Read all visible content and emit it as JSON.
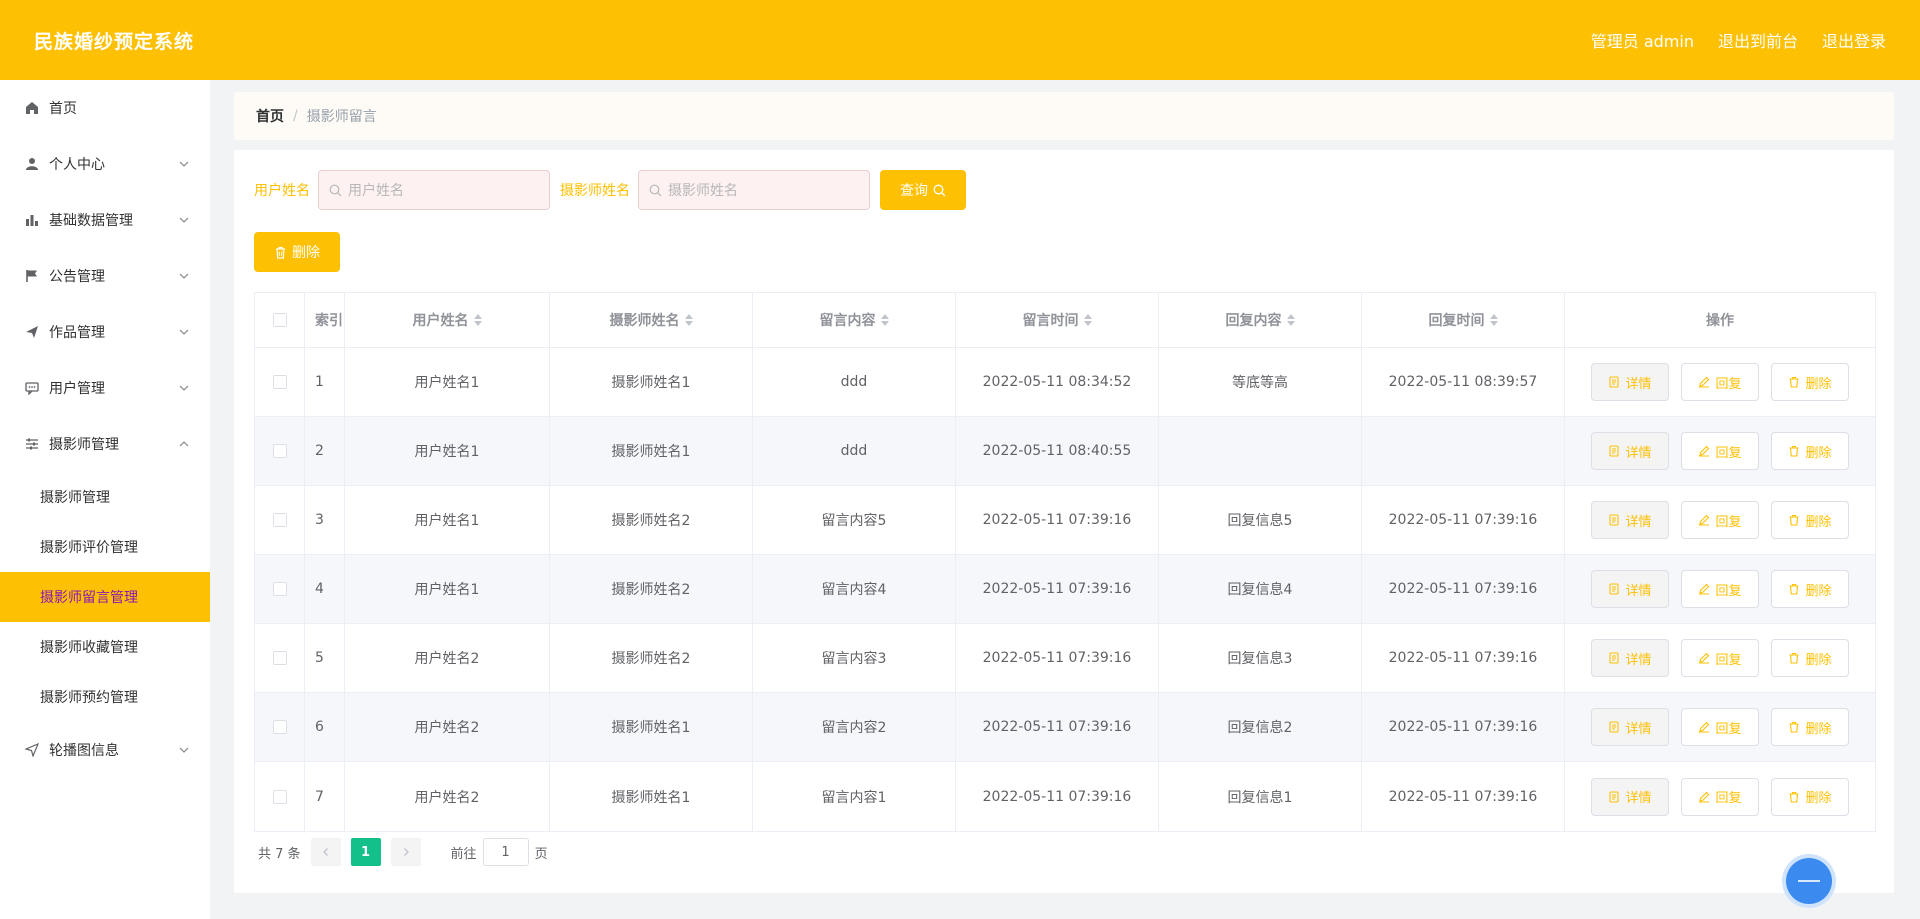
{
  "header": {
    "title": "民族婚纱预定系统",
    "admin": "管理员 admin",
    "to_front": "退出到前台",
    "logout": "退出登录"
  },
  "sidebar": {
    "items": [
      {
        "label": "首页",
        "icon": "home-icon"
      },
      {
        "label": "个人中心",
        "icon": "user-icon"
      },
      {
        "label": "基础数据管理",
        "icon": "bar-chart-icon"
      },
      {
        "label": "公告管理",
        "icon": "flag-icon"
      },
      {
        "label": "作品管理",
        "icon": "send-icon"
      },
      {
        "label": "用户管理",
        "icon": "chat-icon"
      },
      {
        "label": "摄影师管理",
        "icon": "sliders-icon"
      },
      {
        "label": "轮播图信息",
        "icon": "navigation-icon"
      }
    ],
    "sub_items": [
      "摄影师管理",
      "摄影师评价管理",
      "摄影师留言管理",
      "摄影师收藏管理",
      "摄影师预约管理"
    ]
  },
  "breadcrumb": {
    "home": "首页",
    "separator": "/",
    "current": "摄影师留言"
  },
  "filters": {
    "user_label": "用户姓名",
    "user_placeholder": "用户姓名",
    "photographer_label": "摄影师姓名",
    "photographer_placeholder": "摄影师姓名",
    "query_button": "查询",
    "delete_button": "删除"
  },
  "table": {
    "headers": [
      "索引",
      "用户姓名",
      "摄影师姓名",
      "留言内容",
      "留言时间",
      "回复内容",
      "回复时间",
      "操作"
    ],
    "rows": [
      [
        "1",
        "用户姓名1",
        "摄影师姓名1",
        "ddd",
        "2022-05-11 08:34:52",
        "等底等高",
        "2022-05-11 08:39:57"
      ],
      [
        "2",
        "用户姓名1",
        "摄影师姓名1",
        "ddd",
        "2022-05-11 08:40:55",
        "",
        ""
      ],
      [
        "3",
        "用户姓名1",
        "摄影师姓名2",
        "留言内容5",
        "2022-05-11 07:39:16",
        "回复信息5",
        "2022-05-11 07:39:16"
      ],
      [
        "4",
        "用户姓名1",
        "摄影师姓名2",
        "留言内容4",
        "2022-05-11 07:39:16",
        "回复信息4",
        "2022-05-11 07:39:16"
      ],
      [
        "5",
        "用户姓名2",
        "摄影师姓名2",
        "留言内容3",
        "2022-05-11 07:39:16",
        "回复信息3",
        "2022-05-11 07:39:16"
      ],
      [
        "6",
        "用户姓名2",
        "摄影师姓名1",
        "留言内容2",
        "2022-05-11 07:39:16",
        "回复信息2",
        "2022-05-11 07:39:16"
      ],
      [
        "7",
        "用户姓名2",
        "摄影师姓名1",
        "留言内容1",
        "2022-05-11 07:39:16",
        "回复信息1",
        "2022-05-11 07:39:16"
      ]
    ],
    "actions": {
      "detail": "详情",
      "reply": "回复",
      "delete": "删除"
    }
  },
  "pagination": {
    "total": "共 7 条",
    "current_page": "1",
    "goto_label": "前往",
    "goto_value": "1",
    "page_unit": "页"
  },
  "colors": {
    "brand": "#fec003",
    "active_text": "#8a17b8",
    "page_active": "#13c08a"
  }
}
